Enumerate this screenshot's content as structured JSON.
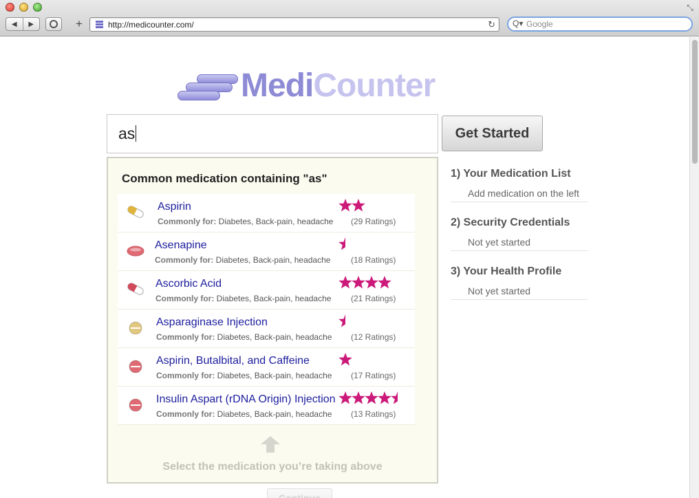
{
  "browser": {
    "url": "http://medicounter.com/",
    "search_placeholder": "Google",
    "back_label": "◀",
    "forward_label": "▶",
    "new_tab_label": "+",
    "reload_label": "↻",
    "search_glyph": "Q▾",
    "resize_glyph": "⤡"
  },
  "logo": {
    "medi": "Medi",
    "counter": "Counter"
  },
  "search": {
    "value": "as"
  },
  "get_started_label": "Get Started",
  "results": {
    "title": "Common medication containing \"as\"",
    "items": [
      {
        "name": "Aspirin",
        "common_label": "Commonly for:",
        "common": "Diabetes, Back-pain, headache",
        "ratings": "(29 Ratings)",
        "stars": 2,
        "pill_colors": [
          "#e0b43a",
          "#ffffff"
        ],
        "pill_icon": "capsule-icon"
      },
      {
        "name": "Asenapine",
        "common_label": "Commonly for:",
        "common": "Diabetes, Back-pain, headache",
        "ratings": "(18 Ratings)",
        "stars": 0.5,
        "pill_colors": [
          "#e06a73",
          "#e06a73"
        ],
        "pill_icon": "tablet-icon"
      },
      {
        "name": "Ascorbic Acid",
        "common_label": "Commonly for:",
        "common": "Diabetes, Back-pain, headache",
        "ratings": "(21 Ratings)",
        "stars": 4,
        "pill_colors": [
          "#d24a5a",
          "#ffffff"
        ],
        "pill_icon": "capsule-icon"
      },
      {
        "name": "Asparaginase Injection",
        "common_label": "Commonly for:",
        "common": "Diabetes, Back-pain, headache",
        "ratings": "(12 Ratings)",
        "stars": 0.5,
        "pill_colors": [
          "#e2c77e",
          "#e2c77e"
        ],
        "pill_icon": "round-pill-icon"
      },
      {
        "name": "Aspirin, Butalbital, and Caffeine",
        "common_label": "Commonly for:",
        "common": "Diabetes, Back-pain, headache",
        "ratings": "(17 Ratings)",
        "stars": 1,
        "pill_colors": [
          "#e06a73",
          "#e06a73"
        ],
        "pill_icon": "round-pill-icon"
      },
      {
        "name": "Insulin Aspart (rDNA Origin) Injection",
        "common_label": "Commonly for:",
        "common": "Diabetes, Back-pain, headache",
        "ratings": "(13 Ratings)",
        "stars": 4.5,
        "pill_colors": [
          "#e06a73",
          "#e06a73"
        ],
        "pill_icon": "round-pill-icon"
      }
    ],
    "hint": "Select the medication you’re taking above"
  },
  "steps": [
    {
      "title": "1) Your Medication List",
      "status": "Add medication on the left"
    },
    {
      "title": "2) Security Credentials",
      "status": "Not yet started"
    },
    {
      "title": "3) Your Health Profile",
      "status": "Not yet started"
    }
  ],
  "continue_label": "Continue",
  "colors": {
    "star": "#cc1a7a",
    "link": "#1d1d9e",
    "panel_bg": "#fbfbf0",
    "logo_primary": "#8e8bd6",
    "logo_secondary": "#c6c4ef"
  }
}
